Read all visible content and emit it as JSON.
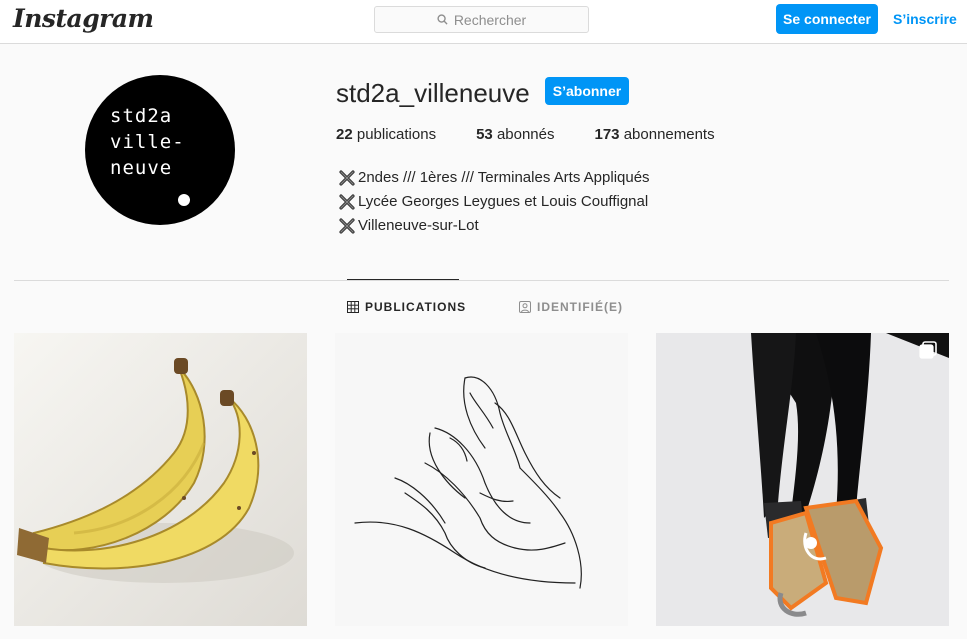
{
  "nav": {
    "logo": "Instagram",
    "search_placeholder": "Rechercher",
    "login_label": "Se connecter",
    "signup_label": "S’inscrire"
  },
  "profile": {
    "avatar_text": "std2a\nville-\nneuve",
    "username": "std2a_villeneuve",
    "follow_label": "S’abonner",
    "stats": [
      {
        "count": "22",
        "label": "publications"
      },
      {
        "count": "53",
        "label": "abonnés"
      },
      {
        "count": "173",
        "label": "abonnements"
      }
    ],
    "bio": [
      "2ndes /// 1ères /// Terminales Arts Appliqués",
      "Lycée Georges Leygues et Louis Couffignal",
      "Villeneuve-sur-Lot"
    ]
  },
  "tabs": [
    {
      "label": "PUBLICATIONS",
      "icon": "grid-icon",
      "active": true
    },
    {
      "label": "IDENTIFIÉ(E)",
      "icon": "tagged-icon",
      "active": false
    }
  ],
  "posts": [
    {
      "subject": "bananas-drawing"
    },
    {
      "subject": "hand-sketch"
    },
    {
      "subject": "legs-with-cardboard-shoes",
      "multiple": true
    }
  ],
  "colors": {
    "accent": "#0095f6",
    "text": "#262626",
    "muted": "#8e8e8e",
    "border": "#dbdbdb",
    "background": "#fafafa"
  }
}
